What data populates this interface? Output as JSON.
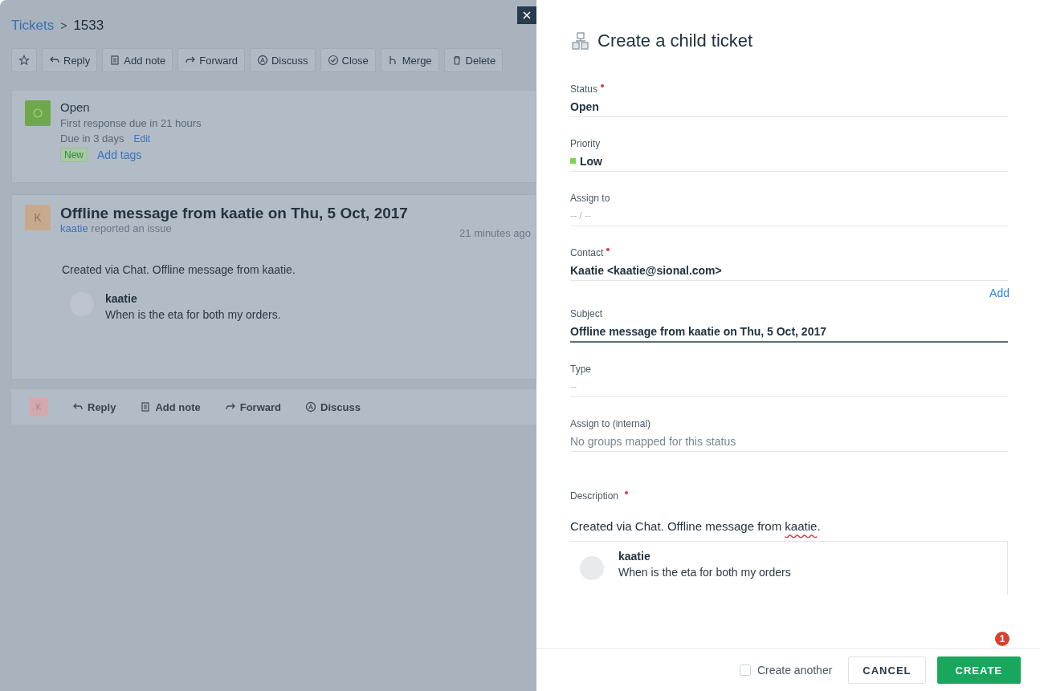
{
  "breadcrumb": {
    "link": "Tickets",
    "separator": ">",
    "current": "1533"
  },
  "toolbar": [
    "Reply",
    "Add note",
    "Forward",
    "Discuss",
    "Close",
    "Merge",
    "Delete"
  ],
  "status_card": {
    "status": "Open",
    "first_response": "First response due in 21 hours",
    "due": "Due in 3 days",
    "edit": "Edit",
    "tag": "New",
    "add_tags": "Add tags"
  },
  "message": {
    "avatar": "K",
    "title": "Offline message from kaatie on Thu, 5 Oct, 2017",
    "author": "kaatie",
    "action": "reported an issue",
    "time": "21 minutes ago",
    "body": "Created via Chat. Offline message from kaatie.",
    "quote_author": "kaatie",
    "quote_text": "When is the eta for both my orders."
  },
  "reply_bar": {
    "avatar": "K",
    "actions": [
      "Reply",
      "Add note",
      "Forward",
      "Discuss"
    ]
  },
  "panel": {
    "title": "Create a child ticket",
    "fields": [
      {
        "label": "Status",
        "required": true,
        "kind": "value",
        "value": "Open",
        "focused": false
      },
      {
        "label": "Priority",
        "required": false,
        "kind": "value",
        "value": "Low",
        "color": "#7ed34f",
        "focused": false
      },
      {
        "label": "Assign to",
        "required": false,
        "kind": "placeholder",
        "placeholder": "-- / --",
        "focused": false
      },
      {
        "label": "Contact",
        "required": true,
        "kind": "value",
        "value": "Kaatie <kaatie@sional.com>",
        "focused": false,
        "link": "Add"
      },
      {
        "label": "Subject",
        "required": false,
        "kind": "value",
        "value": "Offline message from kaatie on Thu, 5 Oct, 2017",
        "focused": true
      },
      {
        "label": "Type",
        "required": false,
        "kind": "placeholder",
        "placeholder": "--",
        "focused": false
      },
      {
        "label": "Assign to (internal)",
        "required": false,
        "kind": "muted",
        "value": "No groups mapped for this status",
        "focused": false
      }
    ],
    "description": {
      "label": "Description",
      "required": true,
      "text": "Created via Chat. Offline message from ",
      "flagged_word": "kaatie",
      "text_end": ".",
      "quote_author": "kaatie",
      "quote_text": "When is the eta for both my orders"
    },
    "badge": "1",
    "create_another": {
      "label": "Create another",
      "checked": false
    },
    "cancel": "CANCEL",
    "create": "CREATE"
  }
}
